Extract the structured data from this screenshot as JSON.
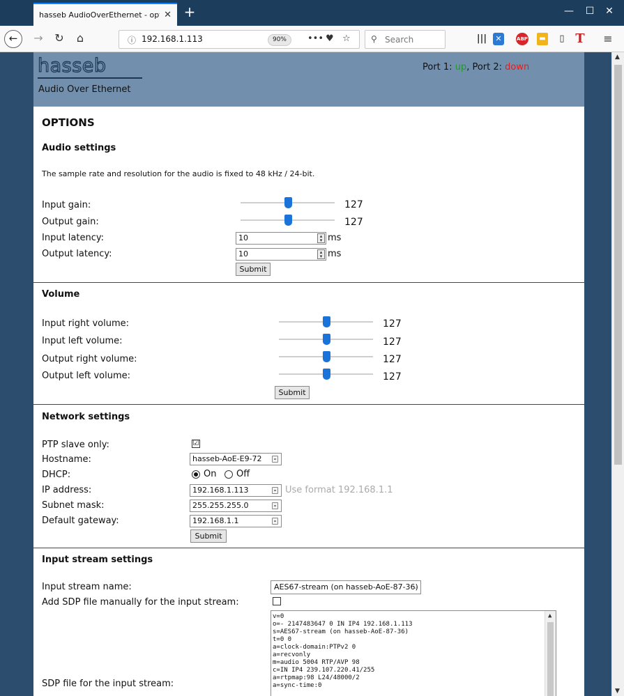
{
  "browser": {
    "tab_title": "hasseb AudioOverEthernet - options",
    "tab_close": "✕",
    "new_tab": "+",
    "window_controls": {
      "minimize": "—",
      "maximize": "☐",
      "close": "✕"
    },
    "url": "192.168.1.113",
    "zoom": "90%",
    "search_placeholder": "Search",
    "icons": [
      "back-icon",
      "forward-icon",
      "reload-icon",
      "home-icon",
      "page-actions-icon",
      "pocket-icon",
      "bookmark-star-icon",
      "search-icon",
      "library-icon",
      "extension-icon",
      "adblock-icon",
      "note-icon",
      "sidebar-icon",
      "t-extension-icon",
      "hamburger-menu-icon"
    ]
  },
  "header": {
    "logo": "hasseb",
    "subtitle": "Audio Over Ethernet",
    "port1_label": "Port 1: ",
    "port1_status": "up",
    "port_sep": ", Port 2: ",
    "port2_status": "down",
    "status_colors": {
      "up": "#1e9c25",
      "down": "#e21d1d"
    }
  },
  "page_title": "OPTIONS",
  "audio": {
    "heading": "Audio settings",
    "note": "The sample rate and resolution for the audio is fixed to 48 kHz / 24-bit.",
    "input_gain_label": "Input gain:",
    "input_gain_value": "127",
    "input_gain_fraction": 0.5,
    "output_gain_label": "Output gain:",
    "output_gain_value": "127",
    "output_gain_fraction": 0.5,
    "input_latency_label": "Input latency:",
    "input_latency_value": "10",
    "output_latency_label": "Output latency:",
    "output_latency_value": "10",
    "unit": "ms",
    "submit": "Submit"
  },
  "volume": {
    "heading": "Volume",
    "sliders": [
      {
        "label": "Input right volume:",
        "value": "127",
        "fraction": 0.5
      },
      {
        "label": "Input left volume:",
        "value": "127",
        "fraction": 0.5
      },
      {
        "label": "Output right volume:",
        "value": "127",
        "fraction": 0.5
      },
      {
        "label": "Output left volume:",
        "value": "127",
        "fraction": 0.5
      }
    ],
    "submit": "Submit"
  },
  "network": {
    "heading": "Network settings",
    "ptp_label": "PTP slave only:",
    "ptp_checked": "☑",
    "hostname_label": "Hostname:",
    "hostname_value": "hasseb-AoE-E9-72",
    "dhcp_label": "DHCP:",
    "dhcp_on": "On",
    "dhcp_off": "Off",
    "ip_label": "IP address:",
    "ip_value": "192.168.1.113",
    "ip_hint": "Use format 192.168.1.1",
    "subnet_label": "Subnet mask:",
    "subnet_value": "255.255.255.0",
    "gateway_label": "Default gateway:",
    "gateway_value": "192.168.1.1",
    "submit": "Submit"
  },
  "input_stream": {
    "heading": "Input stream settings",
    "name_label": "Input stream name:",
    "name_value": "AES67-stream (on hasseb-AoE-87-36)",
    "sdp_manual_label": "Add SDP file manually for the  input stream:",
    "sdp_label": "SDP file for the input stream:",
    "sdp_lines": [
      "v=0",
      "o=- 2147483647 0 IN IP4 192.168.1.113",
      "s=AES67-stream (on hasseb-AoE-87-36)",
      "t=0 0",
      "a=clock-domain:PTPv2 0",
      "a=recvonly",
      "m=audio 5004 RTP/AVP 98",
      "c=IN IP4 239.107.220.41/255",
      "a=rtpmap:98 L24/48000/2",
      "a=sync-time:0"
    ]
  }
}
